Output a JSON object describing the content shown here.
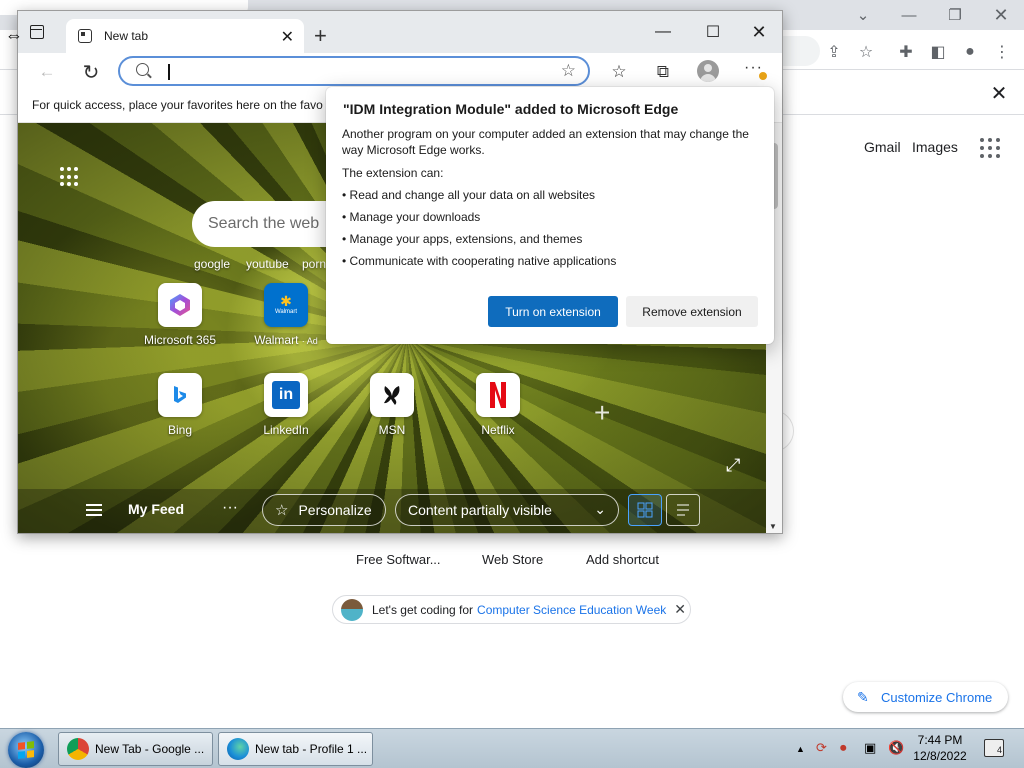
{
  "chrome": {
    "top_links": [
      "Gmail",
      "Images"
    ],
    "shortcuts": [
      "Free Softwar...",
      "Web Store",
      "Add shortcut"
    ],
    "promo": {
      "text": "Let's get coding for",
      "link": "Computer Science Education Week"
    },
    "customize_label": "Customize Chrome"
  },
  "edge": {
    "tab_title": "New tab",
    "favorites_bar_text": "For quick access, place your favorites here on the favo",
    "search_placeholder": "Search the web",
    "quick_links": [
      "google",
      "youtube",
      "porn"
    ],
    "sites_row1": [
      {
        "name": "Microsoft 365",
        "ad": ""
      },
      {
        "name": "Walmart",
        "ad": "· Ad"
      }
    ],
    "sites_row2": [
      {
        "name": "Bing"
      },
      {
        "name": "LinkedIn"
      },
      {
        "name": "MSN"
      },
      {
        "name": "Netflix"
      }
    ],
    "walmart_tile_text": "Walmart",
    "feed": {
      "title": "My Feed",
      "personalize": "Personalize",
      "content_visibility": "Content partially visible"
    }
  },
  "flyout": {
    "title": "\"IDM Integration Module\" added to Microsoft Edge",
    "body": "Another program on your computer added an extension that may change the way Microsoft Edge works.",
    "can_label": "The extension can:",
    "permissions": [
      "• Read and change all your data on all websites",
      "• Manage your downloads",
      "• Manage your apps, extensions, and themes",
      "• Communicate with cooperating native applications"
    ],
    "turn_on": "Turn on extension",
    "remove": "Remove extension"
  },
  "taskbar": {
    "tasks": [
      "New Tab - Google ...",
      "New tab - Profile 1 ..."
    ],
    "time": "7:44 PM",
    "date": "12/8/2022",
    "notification_count": "4"
  },
  "colors": {
    "edge_primary": "#0f6cbd",
    "chrome_link": "#1a73e8",
    "address_focus": "#5b8fd8"
  }
}
